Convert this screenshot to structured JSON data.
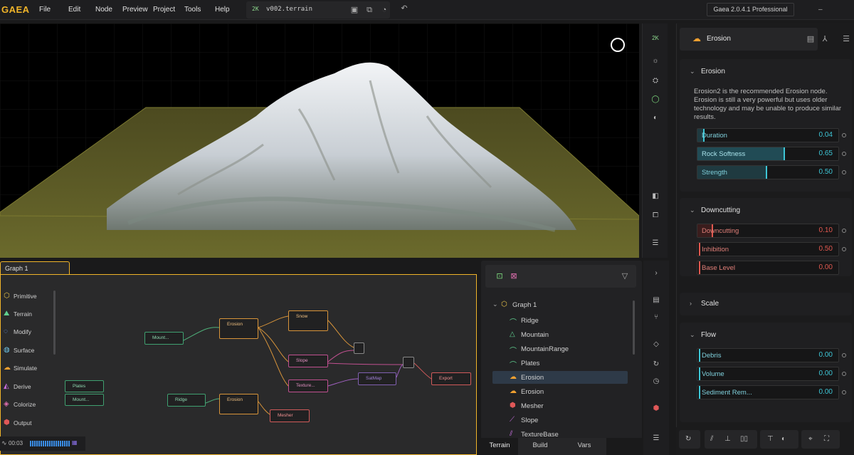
{
  "app": {
    "logo": "GAEA",
    "version": "Gaea 2.0.4.1 Professional"
  },
  "menu": [
    "File",
    "Edit",
    "Node",
    "Preview",
    "Project",
    "Tools",
    "Help"
  ],
  "file": {
    "resolution": "2K",
    "name": "v002.terrain"
  },
  "viewport_toolbar": {
    "resolution": "2K"
  },
  "properties": {
    "node_name": "Erosion",
    "erosion": {
      "title": "Erosion",
      "description": "Erosion2 is the recommended Erosion node. Erosion is still a very powerful but uses older technology and may be unable to produce similar results.",
      "params": [
        {
          "label": "Duration",
          "value": "0.04",
          "fraction": 0.04
        },
        {
          "label": "Rock Softness",
          "value": "0.65",
          "fraction": 0.65
        },
        {
          "label": "Strength",
          "value": "0.50",
          "fraction": 0.5
        }
      ]
    },
    "downcutting": {
      "title": "Downcutting",
      "params": [
        {
          "label": "Downcutting",
          "value": "0.10",
          "fraction": 0.1
        },
        {
          "label": "Inhibition",
          "value": "0.50",
          "fraction": 0.0
        },
        {
          "label": "Base Level",
          "value": "0.00",
          "fraction": 0.0
        }
      ]
    },
    "scale": {
      "title": "Scale"
    },
    "flow": {
      "title": "Flow",
      "params": [
        {
          "label": "Debris",
          "value": "0.00",
          "fraction": 0.0
        },
        {
          "label": "Volume",
          "value": "0.00",
          "fraction": 0.0
        },
        {
          "label": "Sediment Rem...",
          "value": "0.00",
          "fraction": 0.0
        }
      ]
    }
  },
  "graph": {
    "tab": "Graph 1",
    "categories": [
      "Primitive",
      "Terrain",
      "Modify",
      "Surface",
      "Simulate",
      "Derive",
      "Colorize",
      "Output"
    ],
    "nodes": {
      "mount1": "Mount...",
      "erosion1": "Erosion",
      "snow": "Snow",
      "slope": "Slope",
      "texture": "Texture...",
      "satmap": "SatMap",
      "export": "Export",
      "plates": "Plates",
      "mount2": "Mount...",
      "ridge": "Ridge",
      "erosion2": "Erosion",
      "mesher": "Mesher"
    },
    "time": "00:03"
  },
  "tree": {
    "root": "Graph 1",
    "items": [
      "Ridge",
      "Mountain",
      "MountainRange",
      "Plates",
      "Erosion",
      "Erosion",
      "Mesher",
      "Slope",
      "TextureBase"
    ]
  },
  "bottom_tabs": [
    "Terrain",
    "Build",
    "Vars"
  ],
  "colors": {
    "accent": "#f0b429",
    "teal": "#3ec6d6",
    "red": "#e0584f",
    "green": "#5fcf8f"
  }
}
